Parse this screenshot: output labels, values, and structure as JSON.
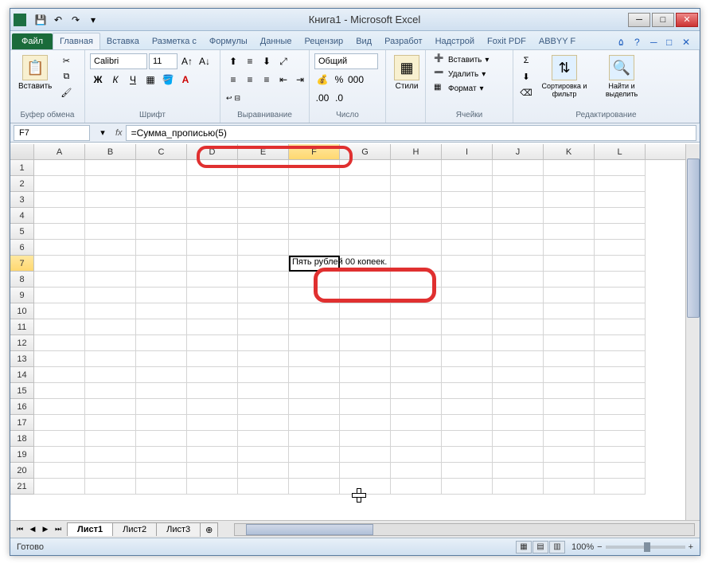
{
  "title": "Книга1 - Microsoft Excel",
  "qat": {
    "save": "💾",
    "undo": "↶",
    "redo": "↷"
  },
  "tabs": {
    "file": "Файл",
    "items": [
      "Главная",
      "Вставка",
      "Разметка с",
      "Формулы",
      "Данные",
      "Рецензир",
      "Вид",
      "Разработ",
      "Надстрой",
      "Foxit PDF",
      "ABBYY F"
    ],
    "active": 0
  },
  "ribbon": {
    "clipboard": {
      "label": "Буфер обмена",
      "paste": "Вставить"
    },
    "font": {
      "label": "Шрифт",
      "name": "Calibri",
      "size": "11"
    },
    "alignment": {
      "label": "Выравнивание"
    },
    "number": {
      "label": "Число",
      "format": "Общий"
    },
    "styles": {
      "label": "Стили",
      "btn": "Стили"
    },
    "cells": {
      "label": "Ячейки",
      "insert": "Вставить",
      "delete": "Удалить",
      "format": "Формат"
    },
    "editing": {
      "label": "Редактирование",
      "sort": "Сортировка и фильтр",
      "find": "Найти и выделить"
    }
  },
  "nameBox": "F7",
  "formula": "=Сумма_прописью(5)",
  "columns": [
    "A",
    "B",
    "C",
    "D",
    "E",
    "F",
    "G",
    "H",
    "I",
    "J",
    "K",
    "L"
  ],
  "activeCol": 5,
  "rows": 21,
  "activeRow": 7,
  "cellValue": "Пять рублей 00 копеек.",
  "sheets": {
    "items": [
      "Лист1",
      "Лист2",
      "Лист3"
    ],
    "active": 0
  },
  "status": "Готово",
  "zoom": "100%"
}
